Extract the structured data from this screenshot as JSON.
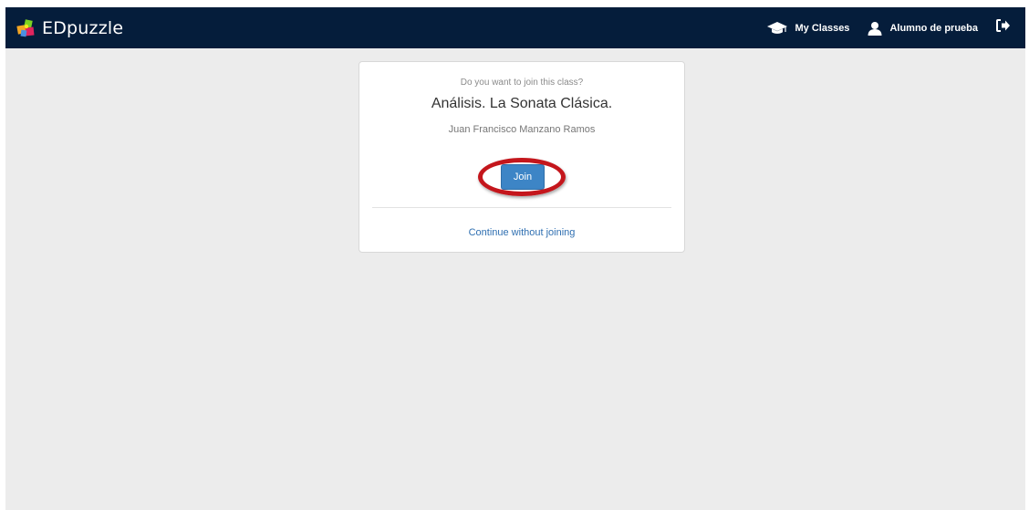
{
  "navbar": {
    "brand_name": "EDpuzzle",
    "my_classes_label": "My Classes",
    "user_name": "Alumno de prueba",
    "icons": {
      "logo": "puzzle-logo-icon",
      "classes": "graduation-cap-icon",
      "user": "user-icon",
      "logout": "sign-out-icon"
    }
  },
  "join_card": {
    "prompt": "Do you want to join this class?",
    "class_name": "Análisis. La Sonata Clásica.",
    "teacher_name": "Juan Francisco Manzano Ramos",
    "join_label": "Join",
    "continue_label": "Continue without joining",
    "highlight_color": "#c4161c"
  },
  "colors": {
    "navbar_bg": "#051d3b",
    "page_bg": "#ececec",
    "primary": "#3d85c6",
    "link": "#2f6fb1"
  }
}
